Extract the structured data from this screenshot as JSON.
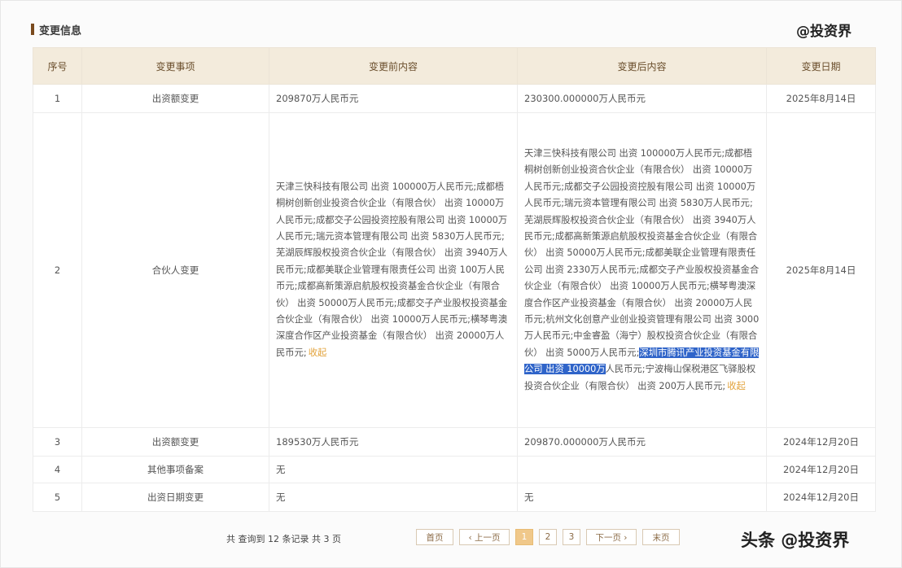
{
  "section": {
    "title": "变更信息"
  },
  "watermark_top": "@投资界",
  "watermark_bottom": "头条 @投资界",
  "table": {
    "headers": [
      "序号",
      "变更事项",
      "变更前内容",
      "变更后内容",
      "变更日期"
    ],
    "rows": [
      {
        "index": "1",
        "item": "出资额变更",
        "before": "209870万人民币元",
        "after": "230300.000000万人民币元",
        "date": "2025年8月14日"
      },
      {
        "index": "2",
        "item": "合伙人变更",
        "before": "天津三快科技有限公司 出资 100000万人民币元;成都梧桐树创新创业投资合伙企业（有限合伙） 出资 10000万人民币元;成都交子公园投资控股有限公司 出资 10000万人民币元;瑞元资本管理有限公司 出资 5830万人民币元;芜湖辰辉股权投资合伙企业（有限合伙） 出资 3940万人民币元;成都美联企业管理有限责任公司 出资 100万人民币元;成都高新策源启航股权投资基金合伙企业（有限合伙） 出资 50000万人民币元;成都交子产业股权投资基金合伙企业（有限合伙） 出资 10000万人民币元;横琴粤澳深度合作区产业投资基金（有限合伙） 出资 20000万人民币元;",
        "before_collapse": "收起",
        "after_pre": "天津三快科技有限公司 出资 100000万人民币元;成都梧桐树创新创业投资合伙企业（有限合伙） 出资 10000万人民币元;成都交子公园投资控股有限公司 出资 10000万人民币元;瑞元资本管理有限公司 出资 5830万人民币元;芜湖辰辉股权投资合伙企业（有限合伙） 出资 3940万人民币元;成都高新策源启航股权投资基金合伙企业（有限合伙） 出资 50000万人民币元;成都美联企业管理有限责任公司 出资 2330万人民币元;成都交子产业股权投资基金合伙企业（有限合伙） 出资 10000万人民币元;横琴粤澳深度合作区产业投资基金（有限合伙） 出资 20000万人民币元;杭州文化创意产业创业投资管理有限公司 出资 3000万人民币元;中金睿盈（海宁）股权投资合伙企业（有限合伙） 出资 5000万人民币元;",
        "after_highlight": "深圳市腾讯产业投资基金有限公司 出资 10000万",
        "after_post": "人民币元;宁波梅山保税港区飞驿股权投资合伙企业（有限合伙） 出资 200万人民币元;",
        "after_collapse": "收起",
        "date": "2025年8月14日"
      },
      {
        "index": "3",
        "item": "出资额变更",
        "before": "189530万人民币元",
        "after": "209870.000000万人民币元",
        "date": "2024年12月20日"
      },
      {
        "index": "4",
        "item": "其他事项备案",
        "before": "无",
        "after": "",
        "date": "2024年12月20日"
      },
      {
        "index": "5",
        "item": "出资日期变更",
        "before": "无",
        "after": "无",
        "date": "2024年12月20日"
      }
    ]
  },
  "pagination": {
    "summary": "共 查询到 12 条记录 共 3 页",
    "first": "首页",
    "prev": "‹ 上一页",
    "pages": [
      "1",
      "2",
      "3"
    ],
    "active_page": "1",
    "next": "下一页 ›",
    "last": "末页"
  },
  "colors": {
    "header_bg": "#f3ebdc",
    "highlight": "#2f64c9",
    "collapse_link": "#e2a23a",
    "active_page": "#f0c88a"
  }
}
